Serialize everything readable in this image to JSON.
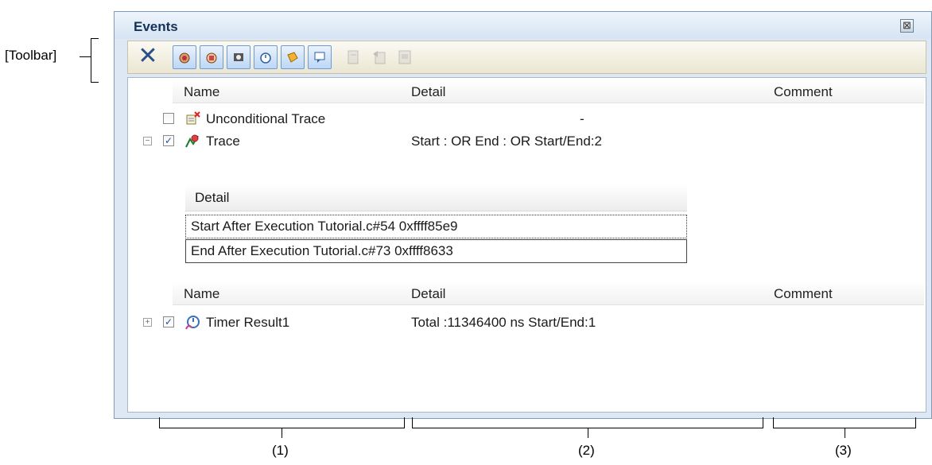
{
  "callout": {
    "toolbar_label": "[Toolbar]"
  },
  "window": {
    "title": "Events",
    "close_symbol": "⊠"
  },
  "toolbar": {
    "delete_symbol": "✕",
    "buttons": [
      {
        "icon": "hardware-break-icon"
      },
      {
        "icon": "software-break-icon"
      },
      {
        "icon": "trace-event-icon"
      },
      {
        "icon": "timer-event-icon"
      },
      {
        "icon": "action-event-icon"
      },
      {
        "icon": "comment-event-icon"
      }
    ],
    "disabled_buttons": [
      {
        "icon": "export-icon"
      },
      {
        "icon": "import-icon"
      },
      {
        "icon": "edit-icon"
      }
    ]
  },
  "table": {
    "columns": {
      "name": "Name",
      "detail": "Detail",
      "comment": "Comment"
    },
    "rows": [
      {
        "name": "Unconditional Trace",
        "detail": "-",
        "checked": false
      },
      {
        "name": "Trace",
        "detail": "Start : OR End : OR Start/End:2",
        "checked": true,
        "expanded": true
      }
    ],
    "trace_detail": {
      "header": "Detail",
      "rows": [
        "Start After Execution Tutorial.c#54 0xffff85e9",
        "End After Execution Tutorial.c#73 0xffff8633"
      ]
    },
    "columns2": {
      "name": "Name",
      "detail": "Detail",
      "comment": "Comment"
    },
    "rows2": [
      {
        "name": "Timer Result1",
        "detail": "Total :11346400 ns   Start/End:1",
        "checked": true,
        "expanded": false
      }
    ]
  },
  "labels": {
    "col1": "(1)",
    "col2": "(2)",
    "col3": "(3)"
  },
  "expander": {
    "collapse": "−",
    "expand": "+"
  },
  "check_mark": "✓"
}
